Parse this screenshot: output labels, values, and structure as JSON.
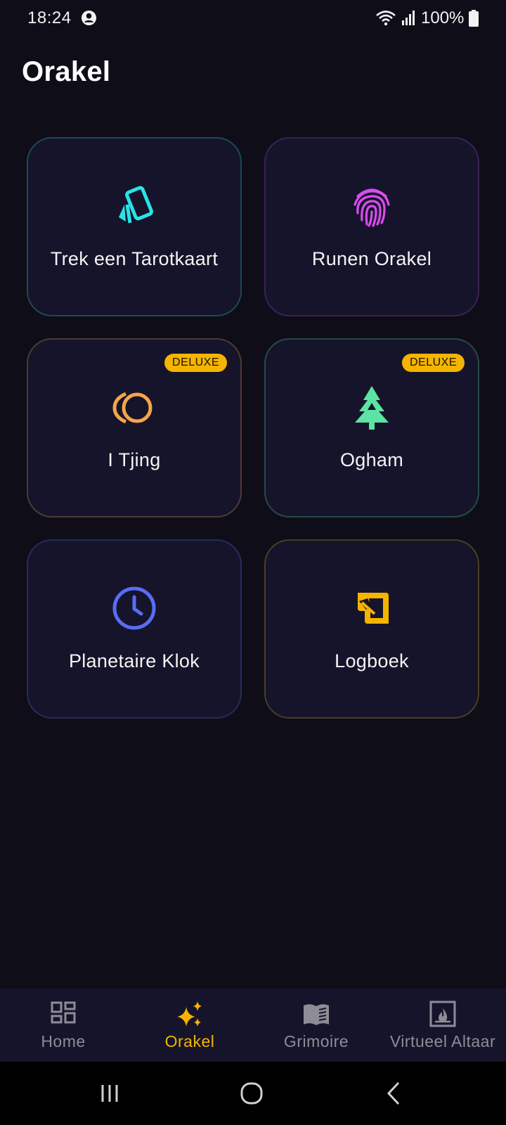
{
  "status_bar": {
    "time": "18:24",
    "battery": "100%",
    "icons": [
      "profile-icon",
      "wifi-icon",
      "signal-icon",
      "battery-icon"
    ]
  },
  "page": {
    "title": "Orakel"
  },
  "cards": [
    {
      "label": "Trek een Tarotkaart",
      "icon": "tarot-cards-icon",
      "accent": "#29e3e8",
      "border": "#1c4a52",
      "badge": ""
    },
    {
      "label": "Runen Orakel",
      "icon": "fingerprint-icon",
      "accent": "#d94cf0",
      "border": "#3d2058",
      "badge": ""
    },
    {
      "label": "I Tjing",
      "icon": "coins-icon",
      "accent": "#f5a54a",
      "border": "#4e3a34",
      "badge": "DELUXE"
    },
    {
      "label": "Ogham",
      "icon": "tree-icon",
      "accent": "#5de3a4",
      "border": "#264a4a",
      "badge": "DELUXE"
    },
    {
      "label": "Planetaire Klok",
      "icon": "clock-icon",
      "accent": "#5a6cf5",
      "border": "#252c5a",
      "badge": ""
    },
    {
      "label": "Logboek",
      "icon": "scroll-icon",
      "accent": "#f4b400",
      "border": "#4a3e22",
      "badge": ""
    }
  ],
  "bottom_nav": {
    "active_color": "#f4b400",
    "inactive_color": "#8d8c97",
    "items": [
      {
        "label": "Home",
        "icon": "dashboard-icon",
        "active": false
      },
      {
        "label": "Orakel",
        "icon": "sparkles-icon",
        "active": true
      },
      {
        "label": "Grimoire",
        "icon": "book-icon",
        "active": false
      },
      {
        "label": "Virtueel Altaar",
        "icon": "fireplace-icon",
        "active": false
      }
    ]
  },
  "system_nav": {
    "buttons": [
      "recents-icon",
      "home-circle-icon",
      "back-icon"
    ]
  }
}
